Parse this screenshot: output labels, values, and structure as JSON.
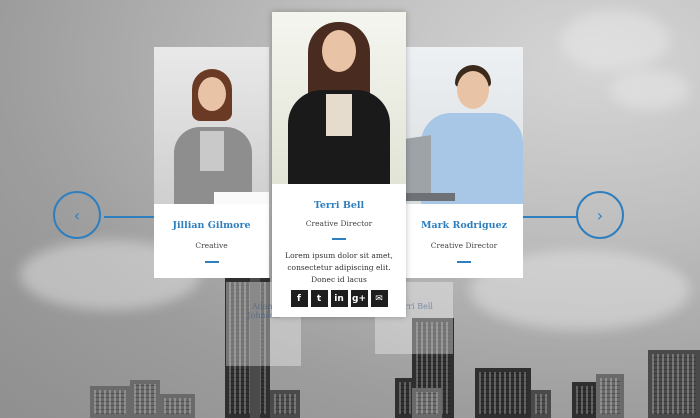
{
  "team": {
    "left": {
      "name": "Jillian Gilmore",
      "role": "Creative"
    },
    "center": {
      "name": "Terri Bell",
      "role": "Creative Director",
      "text": "Lorem ipsum dolor sit amet, consectetur adipiscing elit. Donec id lacus"
    },
    "right": {
      "name": "Mark Rodriguez",
      "role": "Creative Director"
    },
    "ghost_left": {
      "name": "Adam Johnson"
    },
    "ghost_right": {
      "name": "Terri Bell"
    }
  },
  "social": {
    "facebook": "f",
    "twitter": "t",
    "linkedin": "in",
    "googleplus": "g+",
    "email": "✉"
  },
  "nav": {
    "prev": "‹",
    "next": "›"
  },
  "colors": {
    "accent": "#2f7fbf",
    "social_bg": "#1e1e1e"
  }
}
